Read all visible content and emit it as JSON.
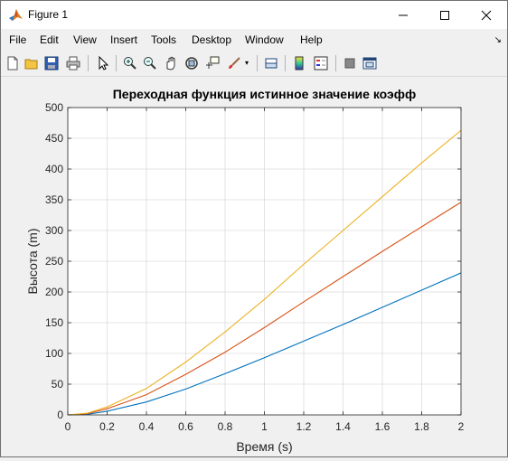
{
  "window": {
    "title": "Figure 1"
  },
  "menu": {
    "file": "File",
    "edit": "Edit",
    "view": "View",
    "insert": "Insert",
    "tools": "Tools",
    "desktop": "Desktop",
    "window": "Window",
    "help": "Help"
  },
  "toolbar": {
    "icons": [
      "new-figure-icon",
      "open-icon",
      "save-icon",
      "print-icon",
      "pointer-icon",
      "zoom-in-icon",
      "zoom-out-icon",
      "pan-icon",
      "rotate-icon",
      "data-cursor-icon",
      "brush-icon",
      "link-icon",
      "colorbar-icon",
      "legend-icon",
      "hide-plot-tools-icon",
      "show-plot-tools-icon"
    ]
  },
  "chart_data": {
    "type": "line",
    "title": "Переходная функция истинное значение коэфф",
    "xlabel": "Время (s)",
    "ylabel": "Высота (m)",
    "xlim": [
      0,
      2
    ],
    "ylim": [
      0,
      500
    ],
    "xticks": [
      "0",
      "0.2",
      "0.4",
      "0.6",
      "0.8",
      "1",
      "1.2",
      "1.4",
      "1.6",
      "1.8",
      "2"
    ],
    "yticks": [
      "0",
      "50",
      "100",
      "150",
      "200",
      "250",
      "300",
      "350",
      "400",
      "450",
      "500"
    ],
    "grid": true,
    "series": [
      {
        "color": "#0072bd",
        "x": [
          0,
          0.1,
          0.2,
          0.4,
          0.6,
          0.8,
          1.0,
          1.2,
          1.4,
          1.6,
          1.8,
          2.0
        ],
        "y": [
          0,
          1,
          6,
          21,
          42,
          67,
          93,
          120,
          147,
          175,
          203,
          231
        ]
      },
      {
        "color": "#d95319",
        "x": [
          0,
          0.1,
          0.2,
          0.4,
          0.6,
          0.8,
          1.0,
          1.2,
          1.4,
          1.6,
          1.8,
          2.0
        ],
        "y": [
          0,
          2,
          10,
          33,
          66,
          102,
          142,
          184,
          225,
          266,
          306,
          346
        ]
      },
      {
        "color": "#edb120",
        "x": [
          0,
          0.1,
          0.2,
          0.4,
          0.6,
          0.8,
          1.0,
          1.2,
          1.4,
          1.6,
          1.8,
          2.0
        ],
        "y": [
          0,
          3,
          13,
          43,
          86,
          135,
          188,
          245,
          300,
          355,
          410,
          463
        ]
      }
    ]
  }
}
